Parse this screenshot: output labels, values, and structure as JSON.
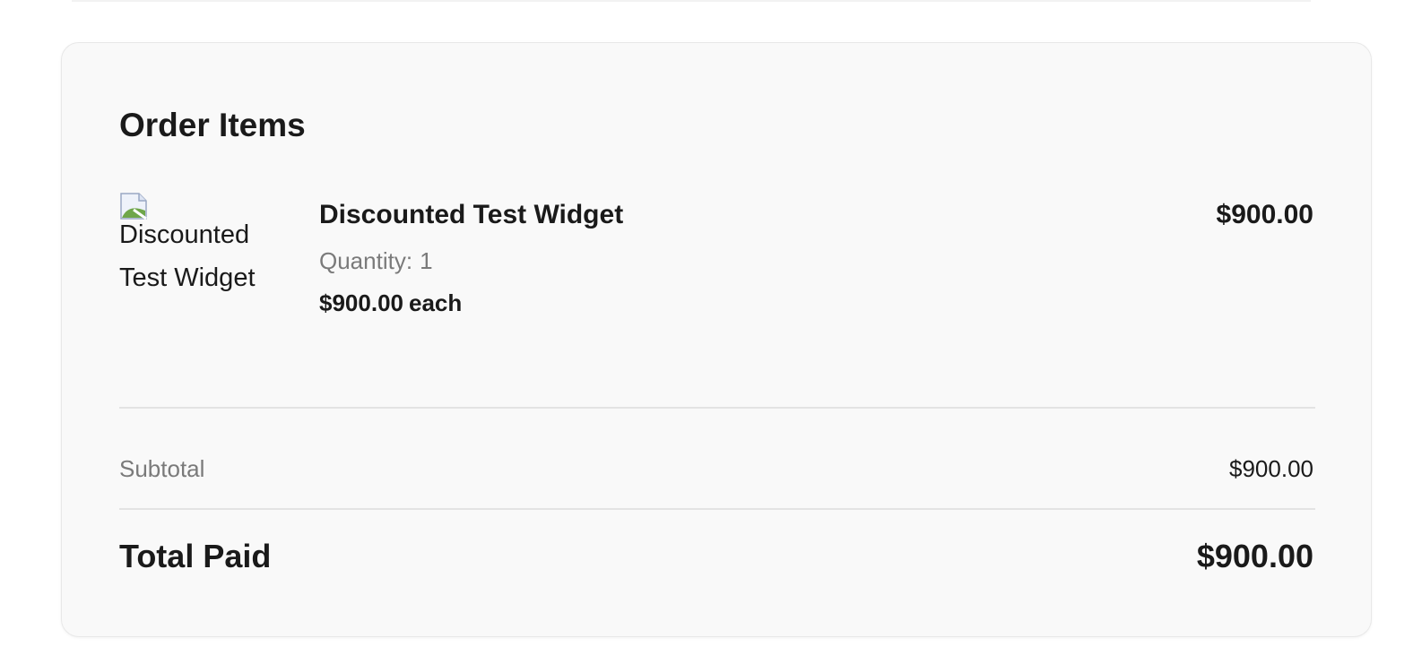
{
  "order_items": {
    "title": "Order Items",
    "items": [
      {
        "image_alt": "Discounted Test Widget",
        "image_icon": "broken-image-icon",
        "name": "Discounted Test Widget",
        "quantity_label": "Quantity:",
        "quantity": "1",
        "unit_price": "$900.00",
        "unit_suffix": "each",
        "line_total": "$900.00"
      }
    ],
    "subtotal_label": "Subtotal",
    "subtotal_value": "$900.00",
    "total_label": "Total Paid",
    "total_value": "$900.00"
  },
  "colors": {
    "card_background": "#f9f9f9",
    "card_border": "#e8e8e8",
    "text_primary": "#1a1a1a",
    "text_muted": "#7a7a7a",
    "divider": "#e3e3e3"
  }
}
